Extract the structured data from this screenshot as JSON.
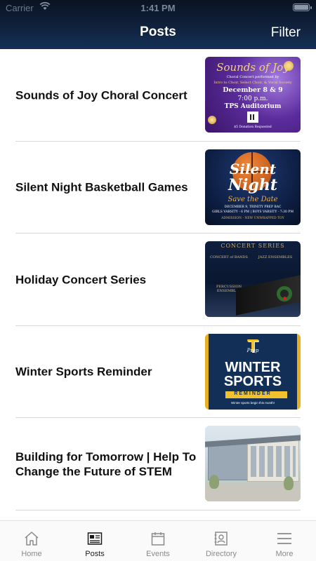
{
  "status_bar": {
    "carrier": "Carrier",
    "time": "1:41 PM"
  },
  "header": {
    "title": "Posts",
    "filter_label": "Filter"
  },
  "posts": [
    {
      "title": "Sounds of Joy Choral Concert",
      "thumb": {
        "script": "Sounds of Joy",
        "line1": "Choral Concert performed by",
        "line2": "Intro to Choir, Select Choir, & Vocal Society",
        "dates": "December 8 & 9",
        "time": "7:00 p.m.",
        "venue": "TPS Auditorium",
        "footer": "$5 Donation Requested"
      }
    },
    {
      "title": "Silent Night Basketball Games",
      "thumb": {
        "word1": "Silent",
        "word2": "Night",
        "save": "Save the Date",
        "line1": "DECEMBER 9, TRINITY PREP BAC",
        "line2": "GIRLS VARSITY - 6 PM | BOYS VARSITY - 7:30 PM",
        "line3": "ADMISSION - NEW UNWRAPPED TOY"
      }
    },
    {
      "title": "Holiday Concert Series",
      "thumb": {
        "header": "CONCERT SERIES",
        "col1": "CONCERT of BANDS",
        "col2": "JAZZ ENSEMBLES",
        "col3": "PERCUSSION ENSEMBLES"
      }
    },
    {
      "title": "Winter Sports Reminder",
      "thumb": {
        "letter": "T",
        "prep": "Prep",
        "word1": "WINTER",
        "word2": "SPORTS",
        "banner": "REMINDER",
        "footer": "Winter sports begin this month!"
      }
    },
    {
      "title": "Building for Tomorrow | Help To Change the Future of STEM",
      "thumb": {}
    }
  ],
  "tabs": [
    {
      "label": "Home",
      "icon": "home-icon",
      "active": false
    },
    {
      "label": "Posts",
      "icon": "newspaper-icon",
      "active": true
    },
    {
      "label": "Events",
      "icon": "calendar-icon",
      "active": false
    },
    {
      "label": "Directory",
      "icon": "contact-card-icon",
      "active": false
    },
    {
      "label": "More",
      "icon": "menu-icon",
      "active": false
    }
  ],
  "colors": {
    "header_bg": "#10233f",
    "tab_active": "#1a1a1a",
    "tab_inactive": "#8a8a8a"
  }
}
